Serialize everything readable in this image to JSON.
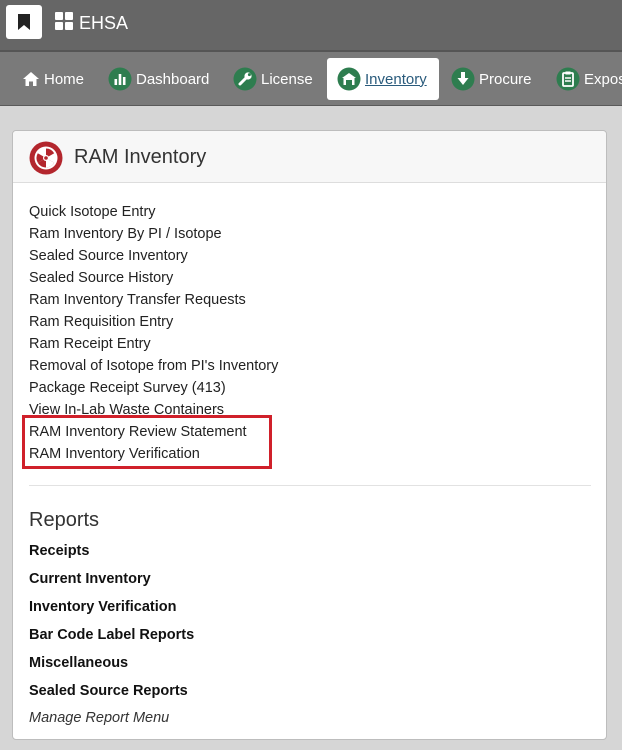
{
  "app": {
    "title": "EHSA"
  },
  "nav": [
    {
      "label": "Home",
      "icon": "home-icon"
    },
    {
      "label": "Dashboard",
      "icon": "dashboard-icon"
    },
    {
      "label": "License",
      "icon": "wrench-icon"
    },
    {
      "label": "Inventory",
      "icon": "inventory-icon",
      "active": true
    },
    {
      "label": "Procure",
      "icon": "arrow-down-icon"
    },
    {
      "label": "Expos",
      "icon": "clipboard-icon"
    }
  ],
  "panel": {
    "title": "RAM Inventory",
    "icon": "radiation-icon",
    "links": [
      "Quick Isotope Entry",
      "Ram Inventory By PI / Isotope",
      "Sealed Source Inventory",
      "Sealed Source History",
      "Ram Inventory Transfer Requests",
      "Ram Requisition Entry",
      "Ram Receipt Entry",
      "Removal of Isotope from PI's Inventory",
      "Package Receipt Survey (413)",
      "View In-Lab Waste Containers",
      "RAM Inventory Review Statement",
      "RAM Inventory Verification"
    ]
  },
  "reports": {
    "title": "Reports",
    "items": [
      "Receipts",
      "Current Inventory",
      "Inventory Verification",
      "Bar Code Label Reports",
      "Miscellaneous",
      "Sealed Source Reports"
    ],
    "manage_label": "Manage Report Menu"
  },
  "colors": {
    "topbar": "#666666",
    "navbar": "#7a7a7a",
    "icon_green": "#2e7d4f",
    "radiation_red": "#b3262d",
    "highlight_red": "#d0202a"
  }
}
